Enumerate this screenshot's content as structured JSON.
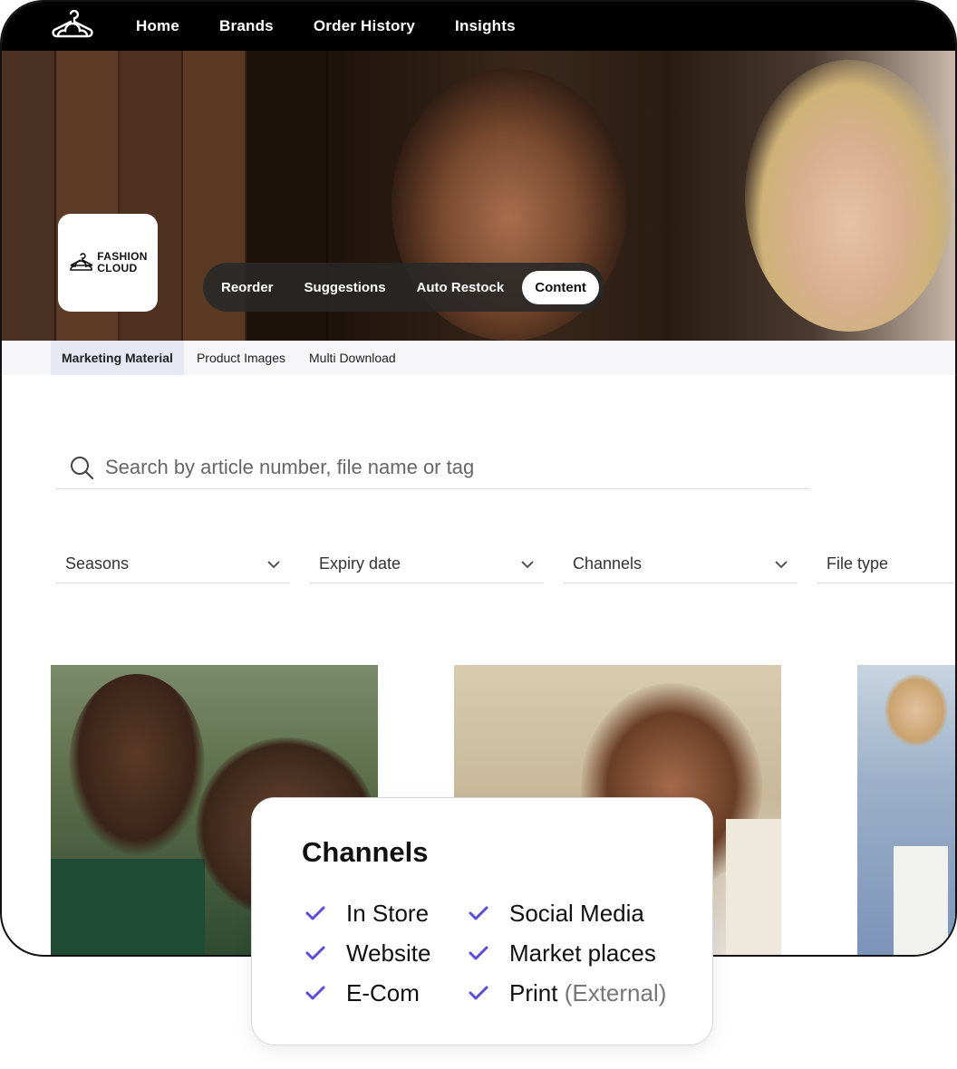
{
  "nav": {
    "logo_icon": "hanger-icon",
    "links": [
      "Home",
      "Brands",
      "Order History",
      "Insights"
    ]
  },
  "brand": {
    "line1": "FASHION",
    "line2": "CLOUD"
  },
  "pill_tabs": [
    "Reorder",
    "Suggestions",
    "Auto Restock",
    "Content"
  ],
  "active_pill": "Content",
  "sub_tabs": [
    "Marketing Material",
    "Product Images",
    "Multi Download"
  ],
  "search": {
    "placeholder": "Search by article number, file name or tag"
  },
  "filters": [
    "Seasons",
    "Expiry date",
    "Channels",
    "File type"
  ],
  "channels_popup": {
    "title": "Channels",
    "items": [
      {
        "label": "In Store",
        "suffix": ""
      },
      {
        "label": "Social Media",
        "suffix": ""
      },
      {
        "label": "Website",
        "suffix": ""
      },
      {
        "label": "Market places",
        "suffix": ""
      },
      {
        "label": "E-Com",
        "suffix": ""
      },
      {
        "label": "Print",
        "suffix": "(External)"
      }
    ]
  },
  "colors": {
    "accent": "#5b4ae0",
    "nav_bg": "#000000",
    "subtab_active": "#e8e8f3"
  }
}
